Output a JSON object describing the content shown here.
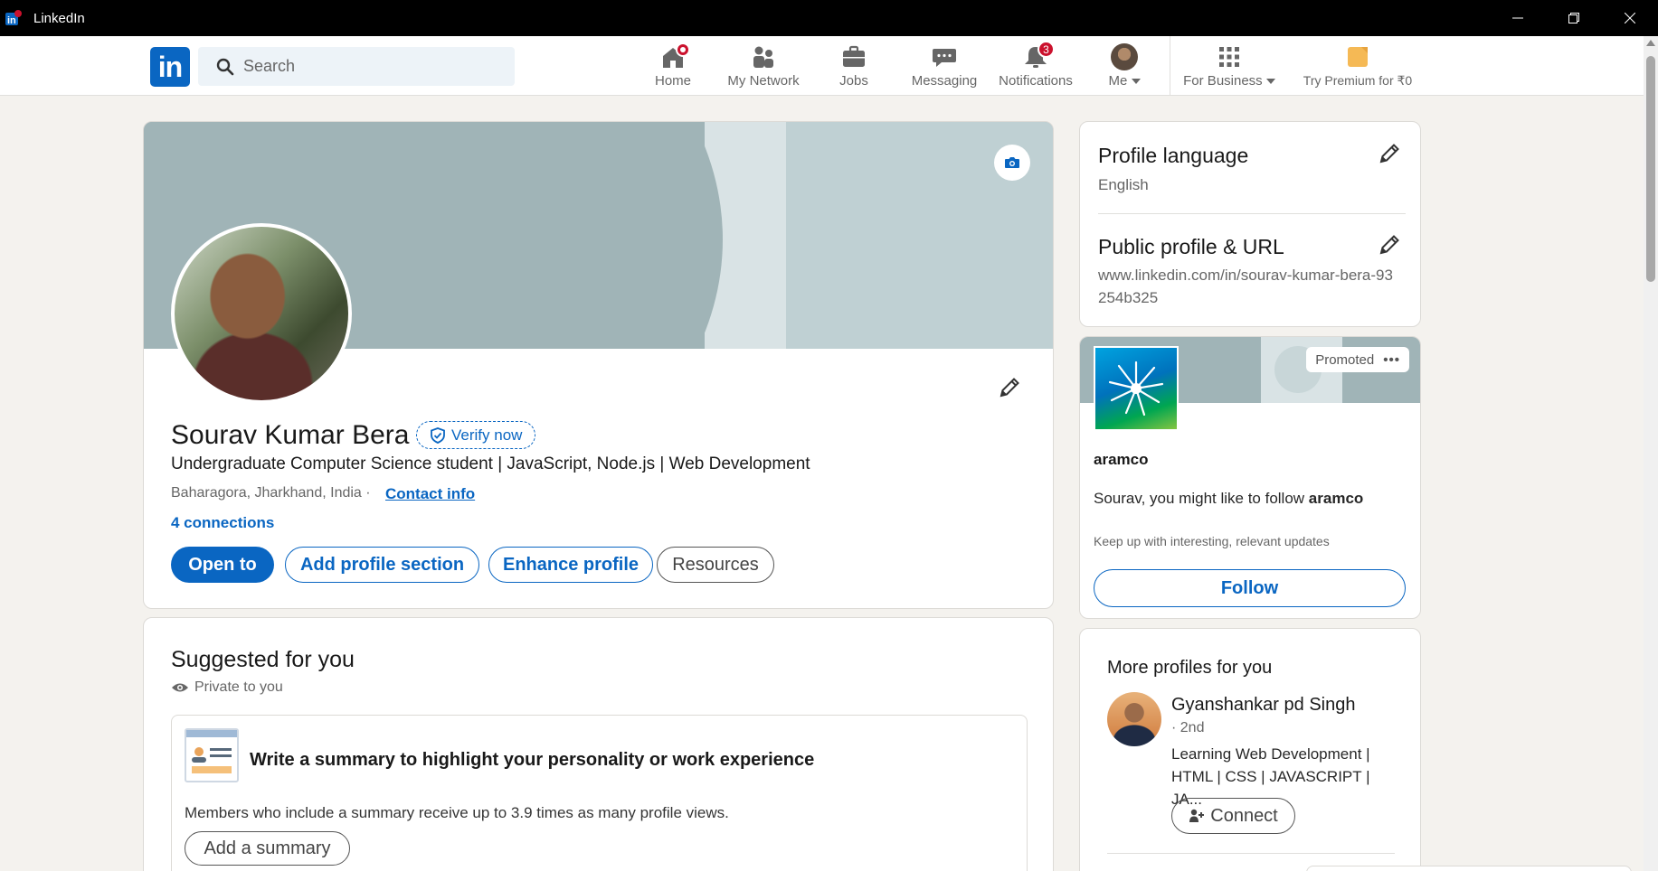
{
  "window": {
    "title": "LinkedIn"
  },
  "nav": {
    "logo_text": "in",
    "search_placeholder": "Search",
    "items": [
      {
        "label": "Home",
        "icon": "home-icon",
        "badge": ""
      },
      {
        "label": "My Network",
        "icon": "network-icon",
        "badge": ""
      },
      {
        "label": "Jobs",
        "icon": "briefcase-icon",
        "badge": ""
      },
      {
        "label": "Messaging",
        "icon": "chat-icon",
        "badge": ""
      },
      {
        "label": "Notifications",
        "icon": "bell-icon",
        "badge": "3"
      },
      {
        "label": "Me",
        "icon": "avatar",
        "badge": ""
      },
      {
        "label": "For Business",
        "icon": "grid-icon",
        "badge": ""
      },
      {
        "label": "Try Premium for ₹0",
        "icon": "premium-icon",
        "badge": ""
      }
    ]
  },
  "profile": {
    "name": "Sourav Kumar Bera",
    "verify_label": "Verify now",
    "headline": "Undergraduate Computer Science student | JavaScript, Node.js | Web Development",
    "location": "Baharagora, Jharkhand, India ·",
    "contact_label": "Contact info",
    "connections": "4 connections",
    "buttons": {
      "open_to": "Open to",
      "add_section": "Add profile section",
      "enhance": "Enhance profile",
      "resources": "Resources"
    }
  },
  "suggested": {
    "title": "Suggested for you",
    "privacy": "Private to you",
    "heading": "Write a summary to highlight your personality or work experience",
    "description": "Members who include a summary receive up to 3.9 times as many profile views.",
    "button": "Add a summary"
  },
  "sidebar": {
    "language_title": "Profile language",
    "language_value": "English",
    "url_title": "Public profile & URL",
    "url_value": "www.linkedin.com/in/sourav-kumar-bera-93254b325"
  },
  "promo": {
    "tag": "Promoted",
    "company": "aramco",
    "message_prefix": "Sourav, you might like to follow ",
    "message_company": "aramco",
    "subtext": "Keep up with interesting, relevant updates",
    "button": "Follow"
  },
  "more_profiles": {
    "title": "More profiles for you",
    "people": [
      {
        "name": "Gyanshankar pd Singh",
        "degree": "· 2nd",
        "description": "Learning Web Development | HTML | CSS | JAVASCRIPT | JA...",
        "button": "Connect"
      }
    ]
  },
  "colors": {
    "brand": "#0a66c2",
    "badge": "#cb112d",
    "background": "#f4f2ee",
    "cover": "#a0b4b7"
  }
}
